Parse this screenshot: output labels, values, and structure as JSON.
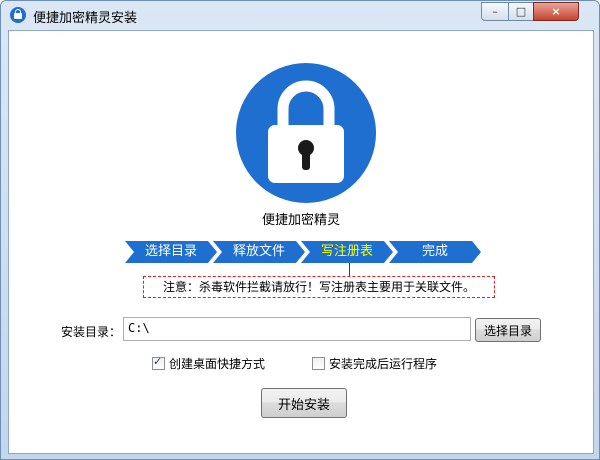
{
  "window": {
    "title": "便捷加密精灵安装"
  },
  "controls": {
    "min": "–",
    "max": "□",
    "close": "×"
  },
  "branding": {
    "product_name": "便捷加密精灵",
    "accent": "#1e6fd0"
  },
  "steps": [
    {
      "label": "选择目录",
      "active": false
    },
    {
      "label": "释放文件",
      "active": false
    },
    {
      "label": "写注册表",
      "active": true
    },
    {
      "label": "完成",
      "active": false
    }
  ],
  "notice": "注意：杀毒软件拦截请放行！写注册表主要用于关联文件。",
  "install_dir": {
    "label": "安装目录：",
    "value": "C:\\"
  },
  "buttons": {
    "browse": "选择目录",
    "install": "开始安装"
  },
  "options": [
    {
      "label": "创建桌面快捷方式",
      "checked": true
    },
    {
      "label": "安装完成后运行程序",
      "checked": false
    }
  ]
}
